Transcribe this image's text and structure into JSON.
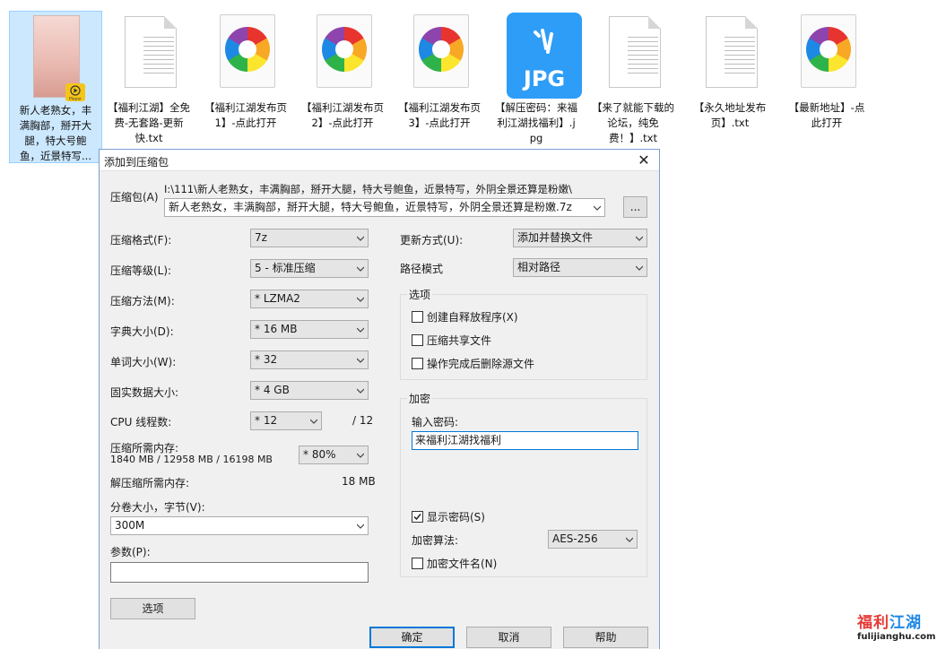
{
  "desktop": {
    "files": [
      {
        "name": "新人老熟女，丰满胸部，掰开大腿，特大号鲍鱼，近景特写...",
        "type": "video",
        "badge": "Player"
      },
      {
        "name": "【福利江湖】全免费-无套路-更新快.txt",
        "type": "txt"
      },
      {
        "name": "【福利江湖发布页1】-点此打开",
        "type": "pinwheel"
      },
      {
        "name": "【福利江湖发布页2】-点此打开",
        "type": "pinwheel"
      },
      {
        "name": "【福利江湖发布页3】-点此打开",
        "type": "pinwheel"
      },
      {
        "name": "【解压密码：来福利江湖找福利】.jpg",
        "type": "jpg",
        "icon_text": "JPG"
      },
      {
        "name": "【来了就能下载的论坛，纯免费！】.txt",
        "type": "txt"
      },
      {
        "name": "【永久地址发布页】.txt",
        "type": "txt"
      },
      {
        "name": "【最新地址】-点此打开",
        "type": "pinwheel"
      }
    ]
  },
  "dialog": {
    "title": "添加到压缩包",
    "archive_label": "压缩包(A)",
    "archive_path": "I:\\111\\新人老熟女，丰满胸部，掰开大腿，特大号鲍鱼，近景特写，外阴全景还算是粉嫩\\",
    "archive_name": "新人老熟女，丰满胸部，掰开大腿，特大号鲍鱼，近景特写，外阴全景还算是粉嫩.7z",
    "browse_label": "...",
    "format_label": "压缩格式(F):",
    "format_value": "7z",
    "level_label": "压缩等级(L):",
    "level_value": "5 - 标准压缩",
    "method_label": "压缩方法(M):",
    "method_value": "*  LZMA2",
    "dict_label": "字典大小(D):",
    "dict_value": "*  16 MB",
    "word_label": "单词大小(W):",
    "word_value": "*  32",
    "solid_label": "固实数据大小:",
    "solid_value": "*  4 GB",
    "threads_label": "CPU 线程数:",
    "threads_value": "*  12",
    "threads_max": "/ 12",
    "mem_label": "压缩所需内存:",
    "mem_value": "1840 MB / 12958 MB / 16198 MB",
    "mem_percent": "* 80%",
    "decomp_label": "解压缩所需内存:",
    "decomp_value": "18 MB",
    "volume_label": "分卷大小，字节(V):",
    "volume_value": "300M",
    "params_label": "参数(P):",
    "params_value": "",
    "options_button": "选项",
    "update_label": "更新方式(U):",
    "update_value": "添加并替换文件",
    "path_label": "路径模式",
    "path_value": "相对路径",
    "options_group": "选项",
    "opt_sfx": {
      "label": "创建自释放程序(X)",
      "checked": false
    },
    "opt_shared": {
      "label": "压缩共享文件",
      "checked": false
    },
    "opt_delete": {
      "label": "操作完成后删除源文件",
      "checked": false
    },
    "enc_group": "加密",
    "pwd_label": "输入密码:",
    "pwd_value": "来福利江湖找福利",
    "show_pwd": {
      "label": "显示密码(S)",
      "checked": true
    },
    "enc_method_label": "加密算法:",
    "enc_method_value": "AES-256",
    "enc_names": {
      "label": "加密文件名(N)",
      "checked": false
    },
    "ok_button": "确定",
    "cancel_button": "取消",
    "help_button": "帮助",
    "close_glyph": "✕"
  },
  "watermark": {
    "cn_left": "福利",
    "cn_right": "江湖",
    "en": "fulijianghu.com"
  },
  "colors": {
    "accent": "#0078d7",
    "selected_bg": "#cce8ff",
    "jpg_icon": "#2e9df7"
  }
}
